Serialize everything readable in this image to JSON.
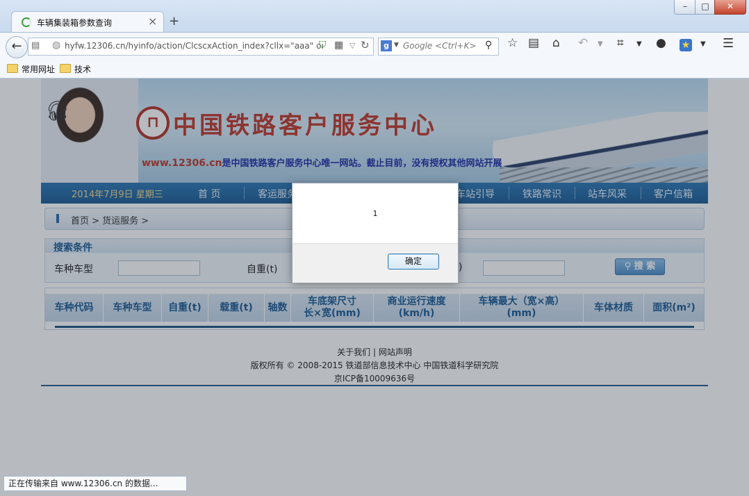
{
  "browser": {
    "tab_title": "车辆集装箱参数查询",
    "new_tab_symbol": "+",
    "url": "hyfw.12306.cn/hyinfo/action/ClcscxAction_index?cllx=\"aaa\" onload=",
    "search_placeholder": "Google <Ctrl+K>",
    "search_engine_letter": "g",
    "bookmarks": [
      "常用网址",
      "技术"
    ],
    "status_text": "正在传输来自 www.12306.cn 的数据..."
  },
  "site": {
    "title": "中国铁路客户服务中心",
    "slogan_url": "www.12306.cn",
    "slogan_text": "是中国铁路客户服务中心唯一网站。截止目前，没有授权其他网站开展",
    "date": "2014年7月9日 星期三",
    "nav": [
      "首 页",
      "客运服务",
      "车站引导",
      "铁路常识",
      "站车风采",
      "客户信箱"
    ],
    "breadcrumb": "首页 > 货运服务 >"
  },
  "search": {
    "title": "搜索条件",
    "field1_label": "车种车型",
    "field1_value": "",
    "field2_label": "自重(t)",
    "field2_value": "",
    "field3_label_partial": ")",
    "field3_value": "",
    "button_label": "搜 索"
  },
  "table": {
    "headers": [
      "车种代码",
      "车种车型",
      "自重(t)",
      "载重(t)",
      "轴数",
      "车底架尺寸\n长×宽(mm)",
      "商业运行速度\n(km/h)",
      "车辆最大（宽×高）\n(mm)",
      "车体材质",
      "面积(m²)"
    ]
  },
  "footer": {
    "links": "关于我们 | 网站声明",
    "copyright": "版权所有 © 2008-2015 铁道部信息技术中心 中国铁道科学研究院",
    "icp": "京ICP备10009636号"
  },
  "dialog": {
    "message": "1",
    "ok_label": "确定"
  },
  "colors": {
    "nav_bar": "#1c5c93",
    "header_text": "#1d5b92",
    "title_red": "#c0392b",
    "overlay": "rgba(30,45,60,0.32)"
  }
}
